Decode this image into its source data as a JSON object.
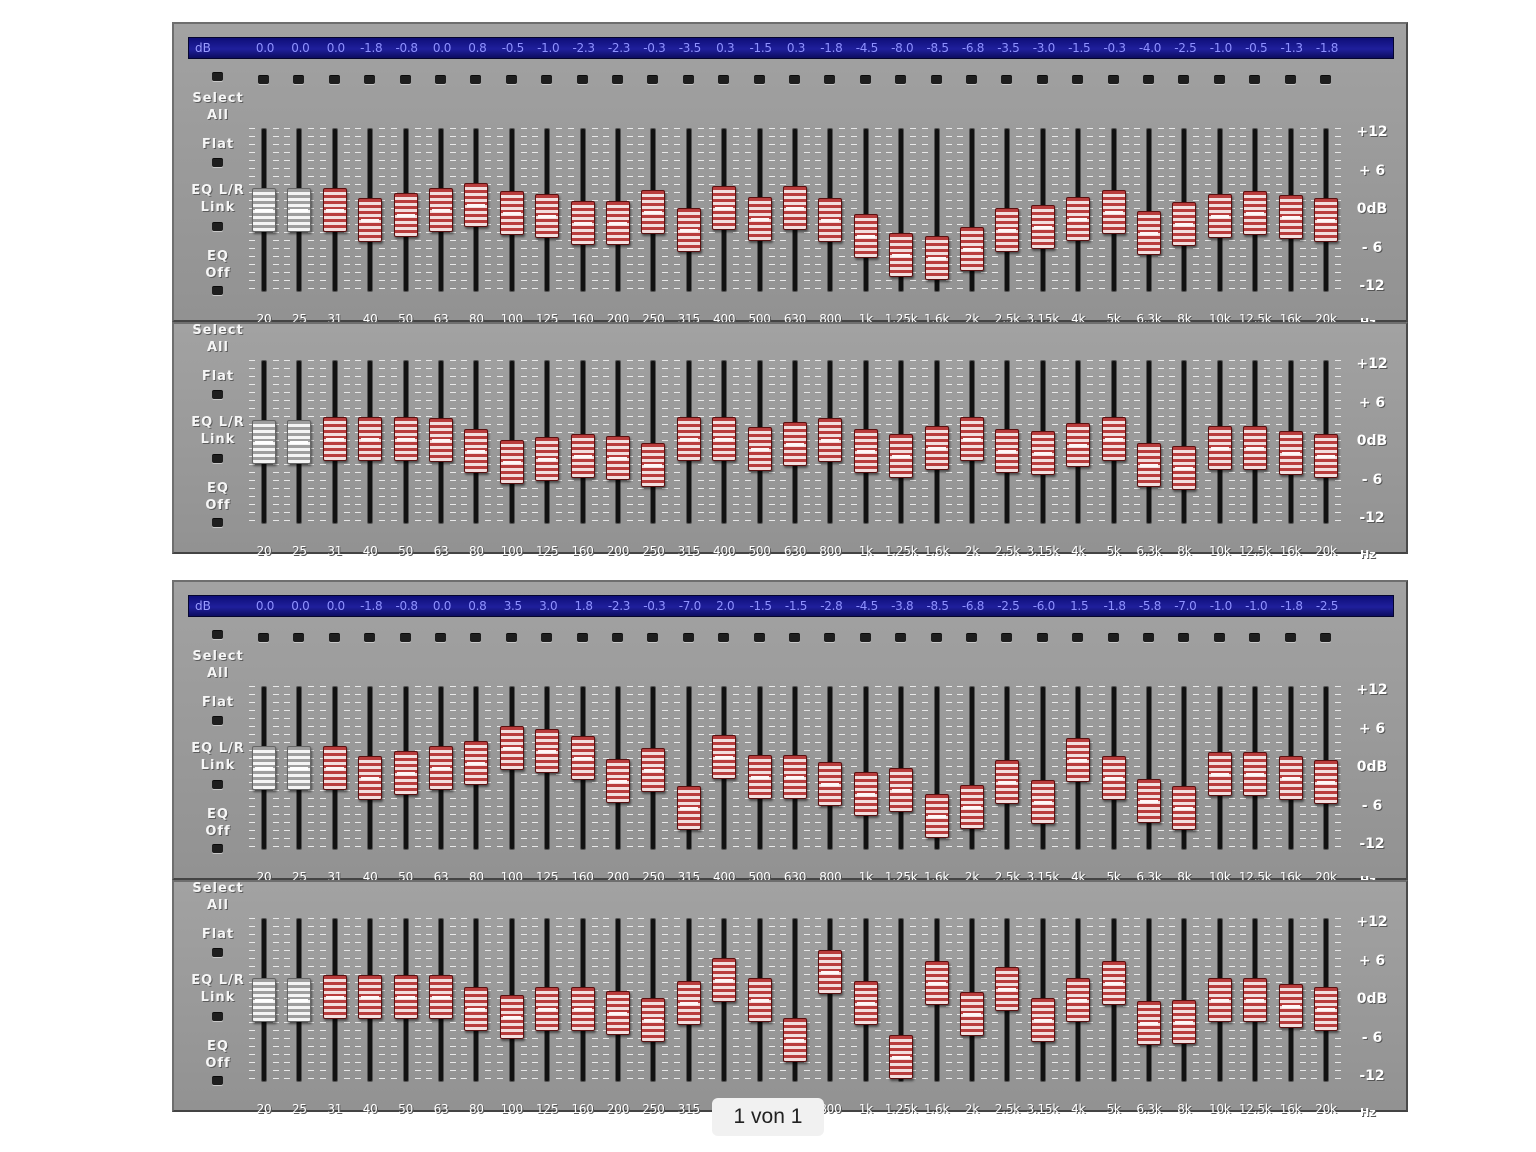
{
  "db_label": "dB",
  "side_labels": {
    "select_all": "Select\nAll",
    "flat": "Flat",
    "link": "EQ L/R\nLink",
    "eq_off": "EQ\nOff"
  },
  "scale_labels": [
    "+12",
    "+ 6",
    "0dB",
    "- 6",
    "-12"
  ],
  "hz_label": "Hz",
  "frequencies": [
    "20",
    "25",
    "31",
    "40",
    "50",
    "63",
    "80",
    "100",
    "125",
    "160",
    "200",
    "250",
    "315",
    "400",
    "500",
    "630",
    "800",
    "1k",
    "1.25k",
    "1.6k",
    "2k",
    "2.5k",
    "3.15k",
    "4k",
    "5k",
    "6.3k",
    "8k",
    "10k",
    "12.5k",
    "16k",
    "20k"
  ],
  "units": [
    {
      "db_values": [
        "0.0",
        "0.0",
        "0.0",
        "-1.8",
        "-0.8",
        "0.0",
        "0.8",
        "-0.5",
        "-1.0",
        "-2.3",
        "-2.3",
        "-0.3",
        "-3.5",
        "0.3",
        "-1.5",
        "0.3",
        "-1.8",
        "-4.5",
        "-8.0",
        "-8.5",
        "-6.8",
        "-3.5",
        "-3.0",
        "-1.5",
        "-0.3",
        "-4.0",
        "-2.5",
        "-1.0",
        "-0.5",
        "-1.3",
        "-1.8"
      ],
      "right_channel_db": [
        0.0,
        0.0,
        0.5,
        0.5,
        0.5,
        0.3,
        -1.5,
        -3.5,
        -3.0,
        -2.5,
        -2.8,
        -4.0,
        0.5,
        0.5,
        -1.3,
        -0.3,
        0.3,
        -1.5,
        -2.5,
        -1.0,
        0.5,
        -1.5,
        -2.0,
        -0.5,
        0.5,
        -4.0,
        -4.5,
        -1.0,
        -1.0,
        -2.0,
        -2.5
      ]
    },
    {
      "db_values": [
        "0.0",
        "0.0",
        "0.0",
        "-1.8",
        "-0.8",
        "0.0",
        "0.8",
        "3.5",
        "3.0",
        "1.8",
        "-2.3",
        "-0.3",
        "-7.0",
        "2.0",
        "-1.5",
        "-1.5",
        "-2.8",
        "-4.5",
        "-3.8",
        "-8.5",
        "-6.8",
        "-2.5",
        "-6.0",
        "1.5",
        "-1.8",
        "-5.8",
        "-7.0",
        "-1.0",
        "-1.0",
        "-1.8",
        "-2.5"
      ],
      "right_channel_db": [
        0.0,
        0.0,
        0.5,
        0.5,
        0.5,
        0.5,
        -1.5,
        -3.0,
        -1.5,
        -1.5,
        -2.3,
        -3.5,
        -0.5,
        3.5,
        0.0,
        -7.0,
        5.0,
        -0.5,
        -10.0,
        3.0,
        -2.5,
        2.0,
        -3.5,
        0.0,
        3.0,
        -4.0,
        -3.8,
        0.0,
        0.0,
        -1.0,
        -1.5
      ]
    }
  ],
  "page_indicator": "1 von 1"
}
